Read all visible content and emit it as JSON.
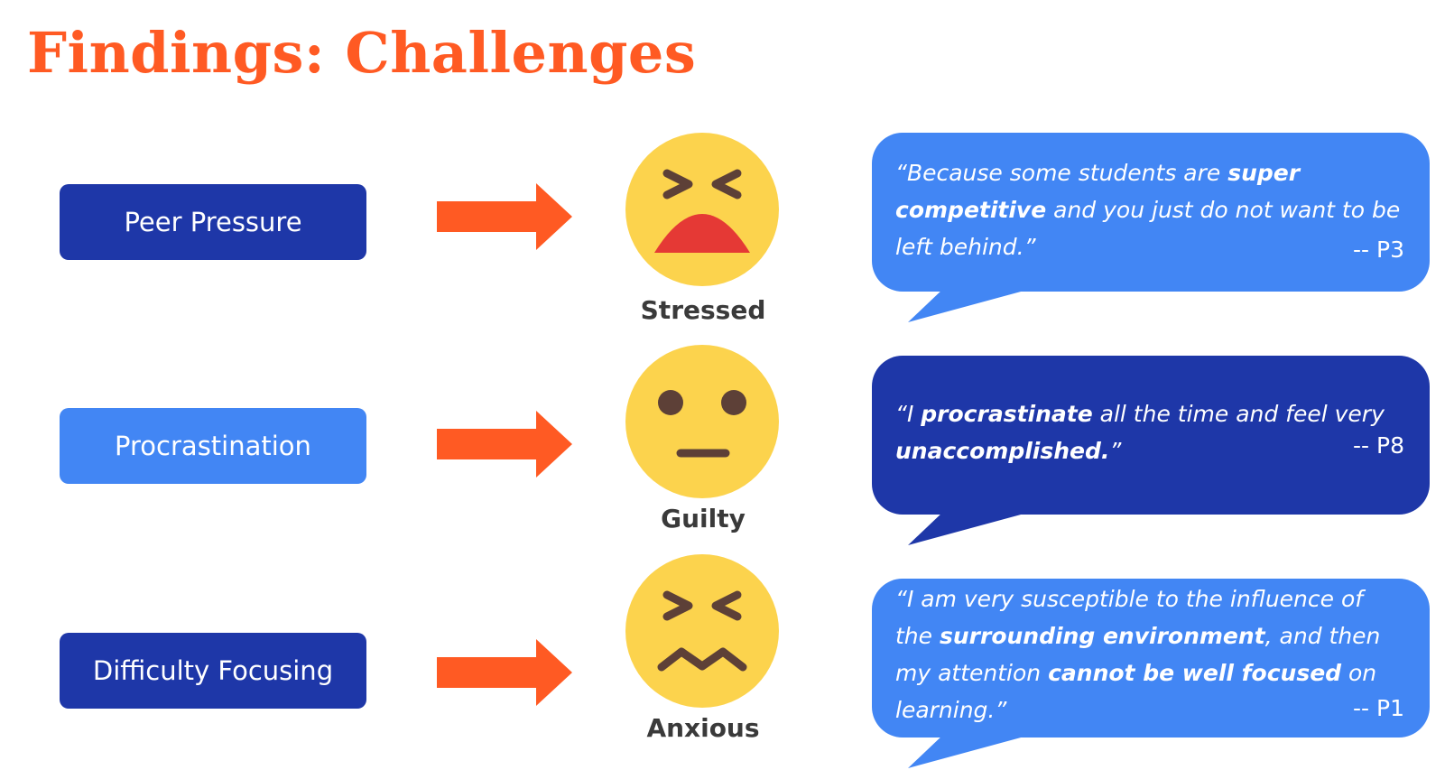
{
  "title": "Findings: Challenges",
  "colors": {
    "accent": "#ff5a23",
    "dark_blue": "#1e37a8",
    "light_blue": "#4286f4",
    "face_yellow": "#fcd34d",
    "mouth_red": "#e53935",
    "feature_brown": "#5d4037"
  },
  "rows": [
    {
      "cause": "Peer Pressure",
      "emotion": "Stressed",
      "face_icon": "stressed-face-icon",
      "quote": {
        "parts": [
          {
            "text": "“Because some students are ",
            "bold": false
          },
          {
            "text": "super competitive",
            "bold": true
          },
          {
            "text": " and you just do not want to be left behind.”",
            "bold": false
          }
        ],
        "attribution": "-- P3"
      }
    },
    {
      "cause": "Procrastination",
      "emotion": "Guilty",
      "face_icon": "neutral-face-icon",
      "quote": {
        "parts": [
          {
            "text": "“I ",
            "bold": false
          },
          {
            "text": "procrastinate",
            "bold": true
          },
          {
            "text": " all the time and feel very ",
            "bold": false
          },
          {
            "text": "unaccomplished.",
            "bold": true
          },
          {
            "text": "”",
            "bold": false
          }
        ],
        "attribution": "-- P8"
      }
    },
    {
      "cause": "Difficulty Focusing",
      "emotion": "Anxious",
      "face_icon": "anxious-face-icon",
      "quote": {
        "parts": [
          {
            "text": "“I am very susceptible to the influence of the ",
            "bold": false
          },
          {
            "text": "surrounding environment",
            "bold": true
          },
          {
            "text": ", and then my attention ",
            "bold": false
          },
          {
            "text": "cannot be well focused",
            "bold": true
          },
          {
            "text": " on learning.”",
            "bold": false
          }
        ],
        "attribution": "-- P1"
      }
    }
  ]
}
